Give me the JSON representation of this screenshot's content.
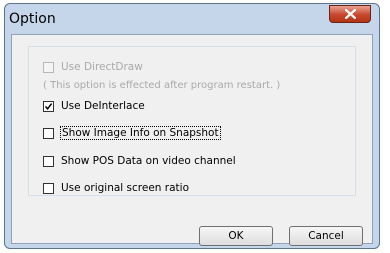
{
  "window": {
    "title": "Option"
  },
  "options": {
    "use_directdraw": {
      "label": "Use DirectDraw",
      "checked": false,
      "enabled": false
    },
    "directdraw_note": "( This option is effected after program restart. )",
    "use_deinterlace": {
      "label": "Use DeInterlace",
      "checked": true,
      "enabled": true
    },
    "show_image_info": {
      "label": "Show Image Info on Snapshot",
      "checked": false,
      "enabled": true,
      "focused": true
    },
    "show_pos_data": {
      "label": "Show POS Data on video channel",
      "checked": false,
      "enabled": true
    },
    "use_original_ratio": {
      "label": "Use original screen ratio",
      "checked": false,
      "enabled": true
    }
  },
  "buttons": {
    "ok_label": "OK",
    "cancel_label": "Cancel"
  },
  "colors": {
    "frame": "#c5d6ea",
    "client": "#f0f0f0",
    "close_button": "#c8472d"
  }
}
